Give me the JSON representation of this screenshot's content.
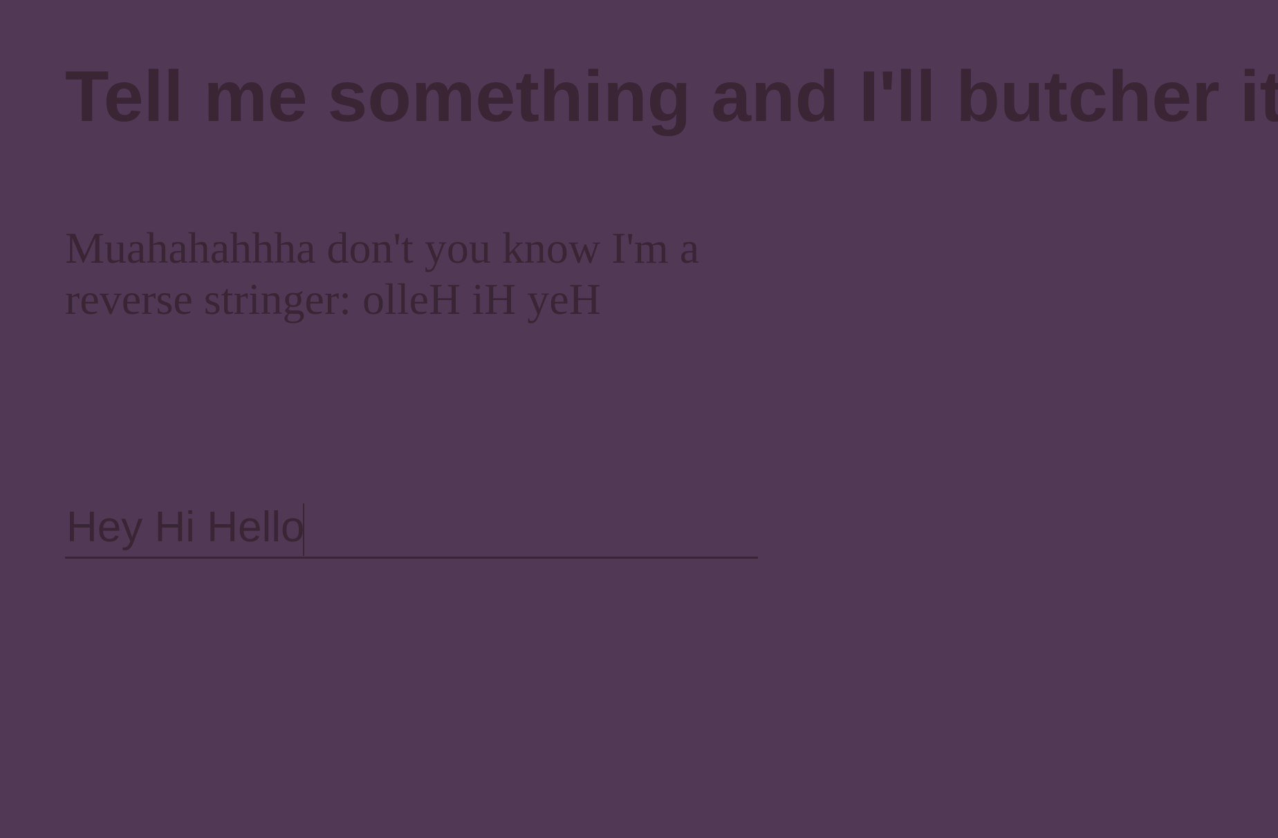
{
  "page": {
    "title": "Tell me something and I'll butcher it",
    "output_text": "Muahahahhha don't you know I'm a reverse stringer: olleH iH yeH",
    "input_value": "Hey Hi Hello"
  },
  "colors": {
    "background": "#513955",
    "text": "#3a2535"
  }
}
